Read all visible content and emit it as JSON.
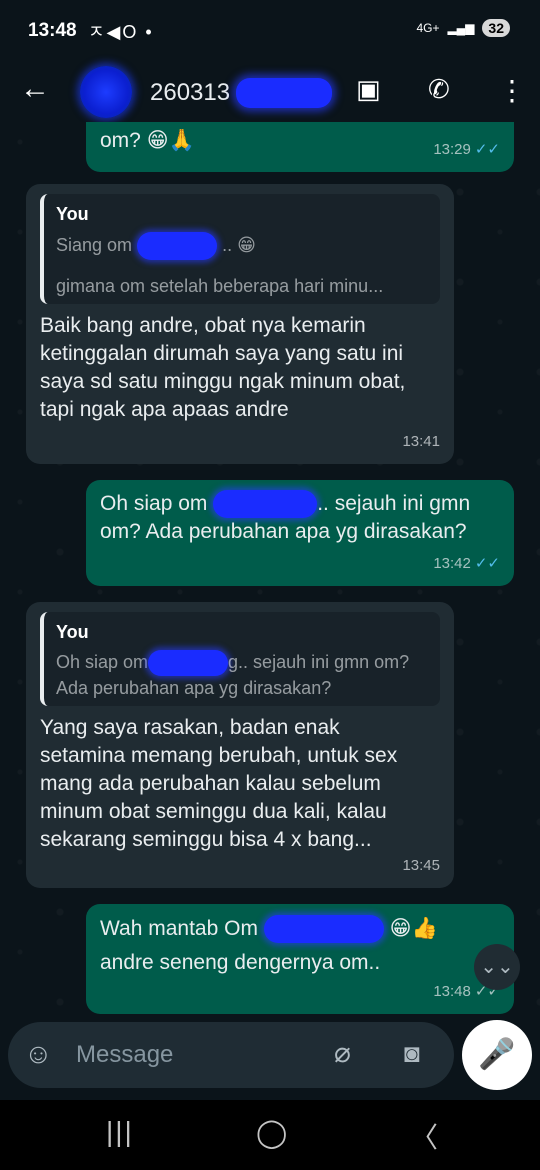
{
  "status_bar": {
    "time": "13:48",
    "left_icons": "ㅈ◀O •",
    "network": "4G+",
    "battery": "32"
  },
  "header": {
    "contact_name": "260313 "
  },
  "messages": [
    {
      "direction": "out",
      "text": "om?",
      "emoji": "😁🙏",
      "time": "13:29",
      "ticks": "✓✓"
    },
    {
      "direction": "in",
      "quote_author": "You",
      "quote_line1": "Siang om",
      "quote_line1_suffix": ".. 😁",
      "quote_line2": "gimana om setelah beberapa hari minu...",
      "text": "Baik bang andre, obat nya kemarin ketinggalan dirumah saya yang satu ini saya sd satu minggu ngak minum obat, tapi ngak apa apaas andre",
      "time": "13:41"
    },
    {
      "direction": "out",
      "text_prefix": "Oh siap om ",
      "text_suffix": ".. sejauh ini gmn om? Ada perubahan apa yg dirasakan?",
      "time": "13:42",
      "ticks": "✓✓"
    },
    {
      "direction": "in",
      "quote_author": "You",
      "quote_prefix": "Oh siap om",
      "quote_suffix": "g.. sejauh ini gmn om? Ada perubahan apa yg dirasakan?",
      "text": "Yang saya rasakan, badan enak setamina memang berubah, untuk sex mang ada perubahan kalau sebelum minum obat seminggu dua kali, kalau sekarang seminggu bisa 4 x bang...",
      "time": "13:45"
    },
    {
      "direction": "out",
      "text_prefix": "Wah mantab Om",
      "emoji": "😁👍",
      "text_line2": "andre seneng dengernya om..",
      "time": "13:48",
      "ticks": "✓✓"
    }
  ],
  "input": {
    "placeholder": "Message"
  },
  "colors": {
    "background": "#0b141a",
    "outgoing_bubble": "#005c4b",
    "incoming_bubble": "#202c33",
    "read_ticks": "#53bdeb"
  },
  "icons": [
    "back-arrow-icon",
    "avatar",
    "contact-card-icon",
    "add-call-icon",
    "more-options-icon",
    "emoji-icon",
    "attach-icon",
    "camera-icon",
    "mic-icon",
    "scroll-down-icon",
    "nav-recent-icon",
    "nav-home-icon",
    "nav-back-icon"
  ]
}
